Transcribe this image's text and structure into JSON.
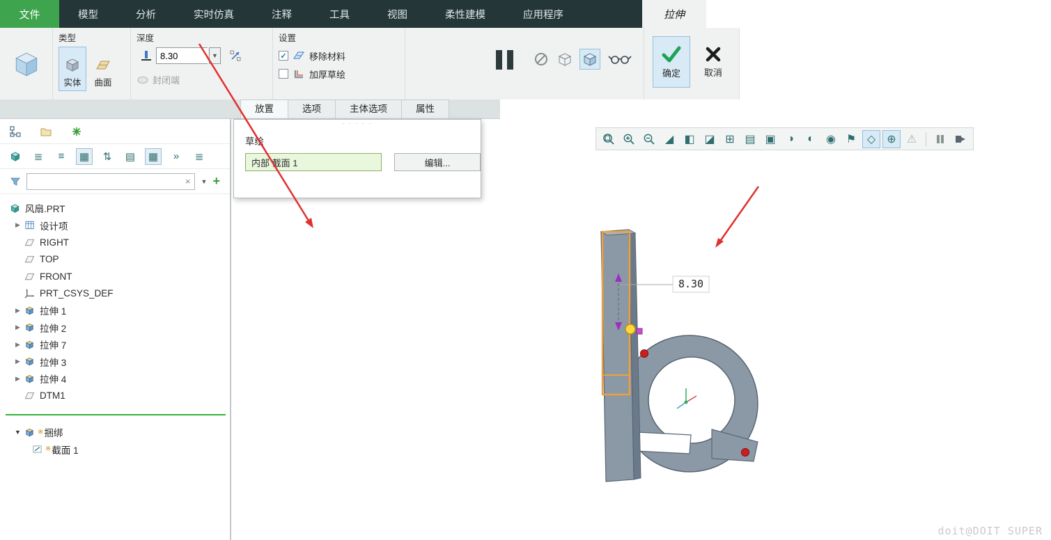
{
  "colors": {
    "menubar_bg": "#253638",
    "file_button_green": "#3fa44e",
    "selection_bg": "#d7eaf6",
    "selection_border": "#96bfdc",
    "ok_check_green": "#1fa356",
    "insert_line_green": "#35b33a",
    "sketch_highlight_orange": "#f0a03a",
    "annotation_arrow_red": "#e03030",
    "model_gray": "#8b98a6"
  },
  "menubar": {
    "file_label": "文件",
    "tabs": [
      {
        "label": "模型"
      },
      {
        "label": "分析"
      },
      {
        "label": "实时仿真"
      },
      {
        "label": "注释"
      },
      {
        "label": "工具"
      },
      {
        "label": "视图"
      },
      {
        "label": "柔性建模"
      },
      {
        "label": "应用程序"
      }
    ],
    "active_tab": "拉伸"
  },
  "ribbon": {
    "type_group": {
      "label": "类型",
      "solid_label": "实体",
      "surface_label": "曲面"
    },
    "depth_group": {
      "label": "深度",
      "depth_value": "8.30",
      "capped_label": "封闭端"
    },
    "settings_group": {
      "label": "设置",
      "remove_material_label": "移除材料",
      "thicken_label": "加厚草绘"
    },
    "confirm_group": {
      "ok_label": "确定",
      "cancel_label": "取消"
    }
  },
  "dashboard_tabs": [
    {
      "label": "放置"
    },
    {
      "label": "选项"
    },
    {
      "label": "主体选项"
    },
    {
      "label": "属性"
    }
  ],
  "placement_panel": {
    "grip": "· · · · ·",
    "sketch_label": "草绘",
    "section_value": "内部 截面 1",
    "edit_label": "编辑..."
  },
  "model_tree": {
    "root_label": "风扇.PRT",
    "items": [
      {
        "label": "设计项",
        "icon": "design-items-icon"
      },
      {
        "label": "RIGHT",
        "icon": "datum-plane-icon"
      },
      {
        "label": "TOP",
        "icon": "datum-plane-icon"
      },
      {
        "label": "FRONT",
        "icon": "datum-plane-icon"
      },
      {
        "label": "PRT_CSYS_DEF",
        "icon": "csys-icon"
      },
      {
        "label": "拉伸 1",
        "icon": "extrude-icon"
      },
      {
        "label": "拉伸 2",
        "icon": "extrude-icon"
      },
      {
        "label": "拉伸 7",
        "icon": "extrude-icon"
      },
      {
        "label": "拉伸 3",
        "icon": "extrude-icon"
      },
      {
        "label": "拉伸 4",
        "icon": "extrude-icon"
      },
      {
        "label": "DTM1",
        "icon": "datum-plane-icon"
      }
    ],
    "pending_marker": "※",
    "pending_items": [
      {
        "label": "捆绑",
        "icon": "extrude-icon"
      },
      {
        "label": "截面 1",
        "icon": "sketch-icon"
      }
    ]
  },
  "viewport_toolbar": {
    "icons": [
      "refit",
      "zoom-in",
      "zoom-out",
      "repaint",
      "display-shaded",
      "display-style",
      "saved-orientations",
      "view-manager",
      "screenshot",
      "section",
      "appearance",
      "scene",
      "annotations",
      "datum-display",
      "spin-center",
      "warning",
      "pause",
      "exit"
    ]
  },
  "viewport": {
    "dimension_value": "8.30",
    "watermark": "doit@DOIT SUPER"
  }
}
